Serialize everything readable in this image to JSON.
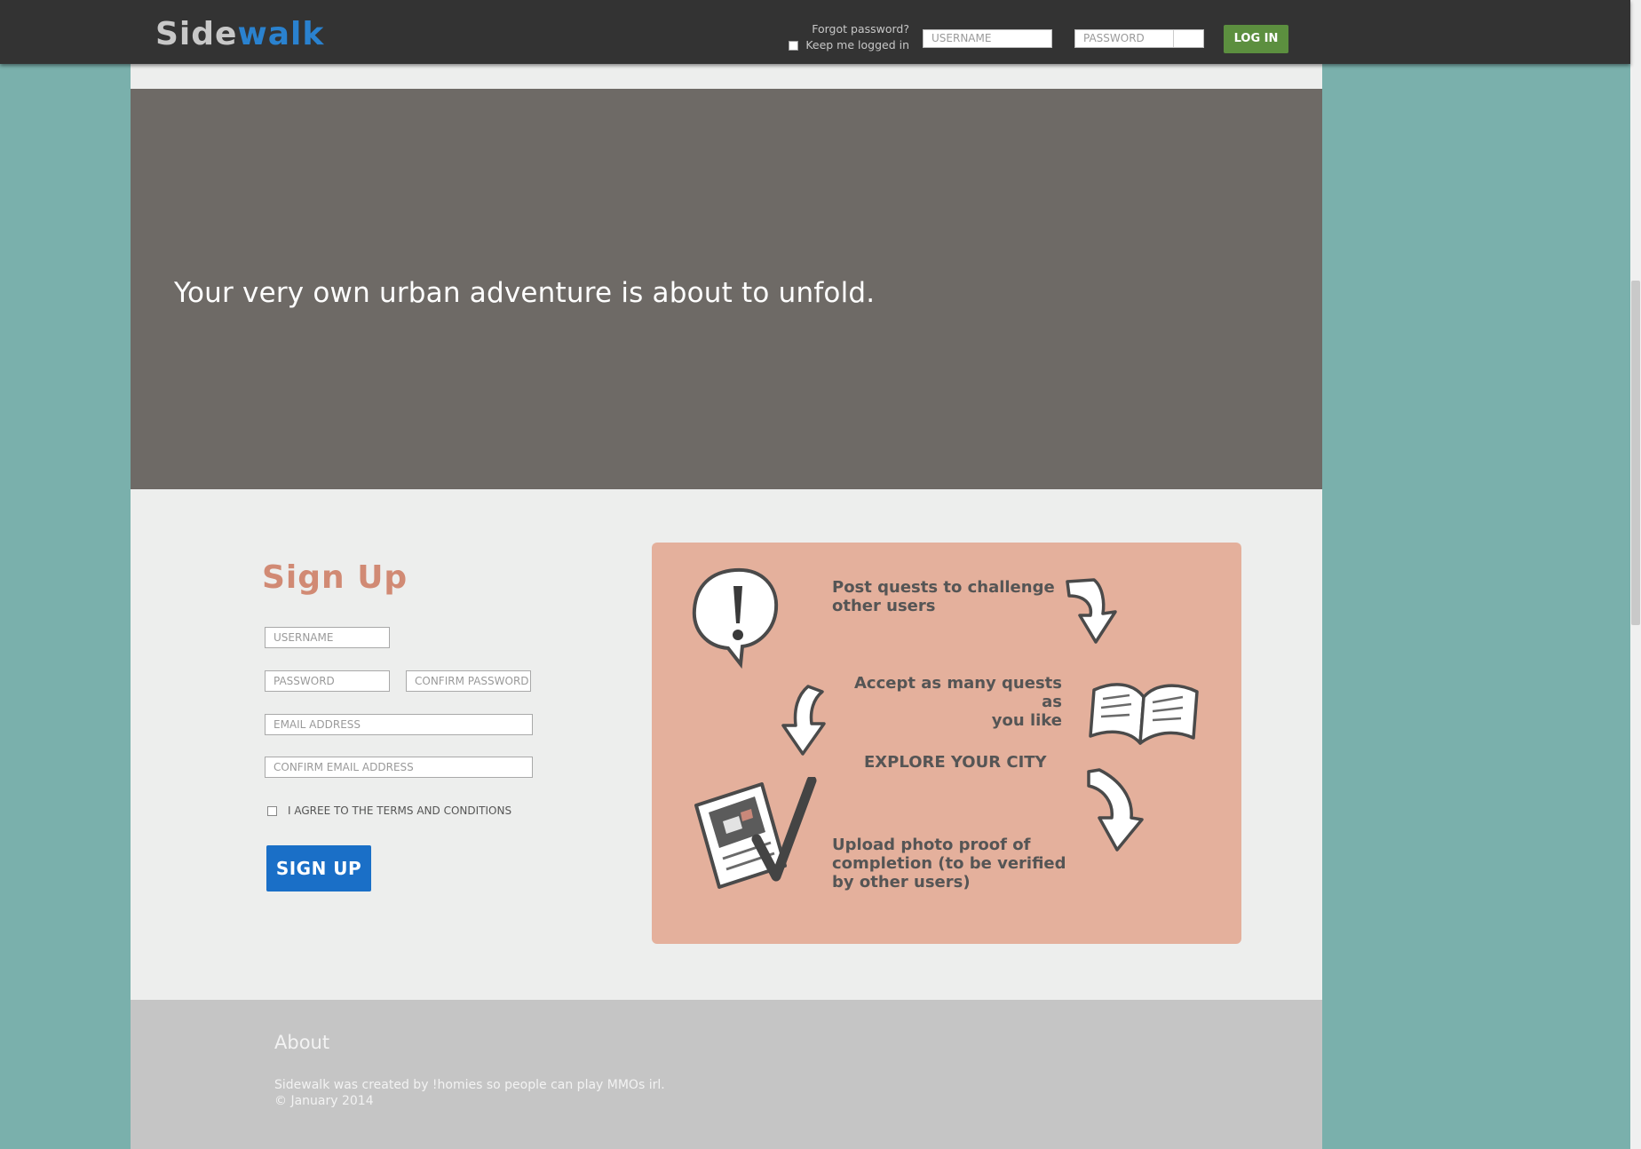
{
  "brand": {
    "part1": "Side",
    "part2": "walk"
  },
  "header": {
    "forgot_password": "Forgot password?",
    "keep_logged_in": "Keep me logged in",
    "username_placeholder": "USERNAME",
    "password_placeholder": "PASSWORD",
    "login_label": "LOG IN"
  },
  "hero": {
    "tagline": "Your very own urban adventure is about to unfold."
  },
  "signup": {
    "title": "Sign Up",
    "username_placeholder": "USERNAME",
    "password_placeholder": "PASSWORD",
    "confirm_password_placeholder": "CONFIRM PASSWORD",
    "email_placeholder": "EMAIL ADDRESS",
    "confirm_email_placeholder": "CONFIRM EMAIL ADDRESS",
    "agree_label": "I AGREE TO THE TERMS AND CONDITIONS",
    "button_label": "SIGN UP"
  },
  "info": {
    "step1_line1": "Post quests to challenge",
    "step1_line2": "other users",
    "step2_line1": "Accept as many quests as",
    "step2_line2": "you like",
    "step3": "EXPLORE YOUR CITY",
    "step4_line1": "Upload photo proof of",
    "step4_line2": "completion (to be verified",
    "step4_line3": "by other users)"
  },
  "footer": {
    "title": "About",
    "line1": "Sidewalk was created by !homies so people can play MMOs irl.",
    "line2": "© January 2014"
  }
}
